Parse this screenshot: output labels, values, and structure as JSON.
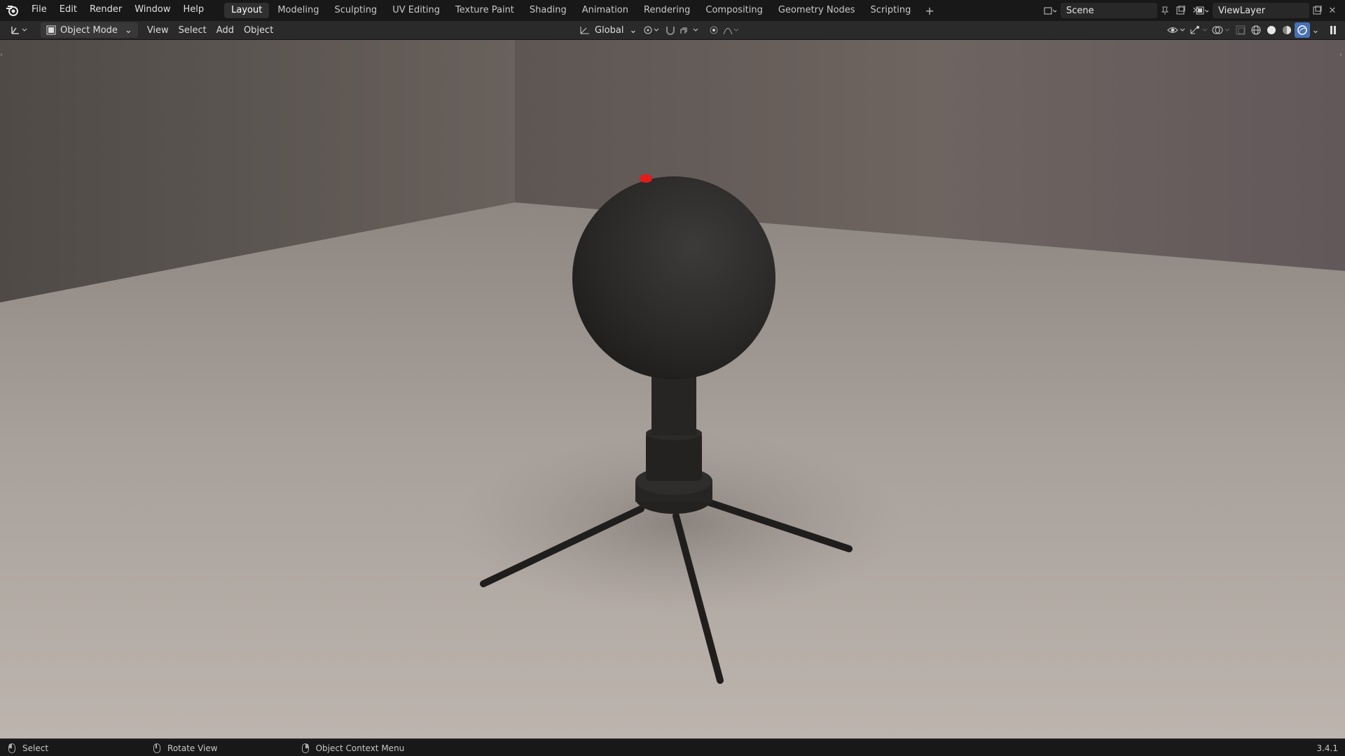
{
  "menus": [
    "File",
    "Edit",
    "Render",
    "Window",
    "Help"
  ],
  "workspaces": [
    "Layout",
    "Modeling",
    "Sculpting",
    "UV Editing",
    "Texture Paint",
    "Shading",
    "Animation",
    "Rendering",
    "Compositing",
    "Geometry Nodes",
    "Scripting"
  ],
  "active_workspace": "Layout",
  "scene_name": "Scene",
  "view_layer": "ViewLayer",
  "header": {
    "mode": "Object Mode",
    "view": "View",
    "select": "Select",
    "add": "Add",
    "object": "Object",
    "orientation": "Global"
  },
  "status": {
    "select": "Select",
    "rotate": "Rotate View",
    "context": "Object Context Menu",
    "version": "3.4.1"
  },
  "colors": {
    "accent": "#4772b3",
    "indicator": "#e31b1b"
  }
}
